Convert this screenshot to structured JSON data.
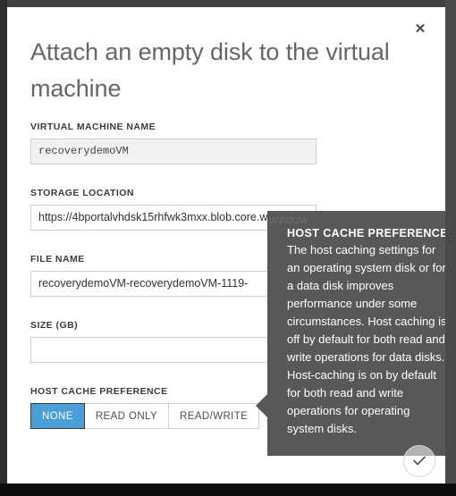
{
  "dialog": {
    "title": "Attach an empty disk to the virtual machine",
    "close_label": "✕"
  },
  "form": {
    "fields": [
      {
        "label": "VIRTUAL MACHINE NAME",
        "value": "recoverydemoVM",
        "placeholder": "",
        "disabled": true
      },
      {
        "label": "STORAGE LOCATION",
        "value": "https://4bportalvhdsk15rhfwk3mxx.blob.core.windows.net/vhds/",
        "placeholder": "",
        "disabled": false
      },
      {
        "label": "FILE NAME",
        "value": "recoverydemoVM-recoverydemoVM-1119-",
        "placeholder": "",
        "disabled": false
      },
      {
        "label": "SIZE (GB)",
        "value": "",
        "placeholder": "",
        "disabled": false
      }
    ],
    "host_cache": {
      "label": "HOST CACHE PREFERENCE",
      "options": [
        "NONE",
        "READ ONLY",
        "READ/WRITE"
      ],
      "selected": "NONE",
      "help_icon_glyph": "?"
    }
  },
  "tooltip": {
    "title": "HOST CACHE PREFERENCE",
    "body": "The host caching settings for an operating system disk or for a data disk improves performance under some circumstances. Host caching is off by default for both read and write operations for data disks. Host-caching is on by default for both read and write operations for operating system disks.",
    "background_color": "#585858"
  },
  "background_text": "window",
  "confirm": {
    "label": "✓"
  },
  "colors": {
    "accent": "#4a9fd8",
    "help_icon": "#42a0da",
    "title_text": "#666666",
    "tooltip_bg": "#585858"
  }
}
